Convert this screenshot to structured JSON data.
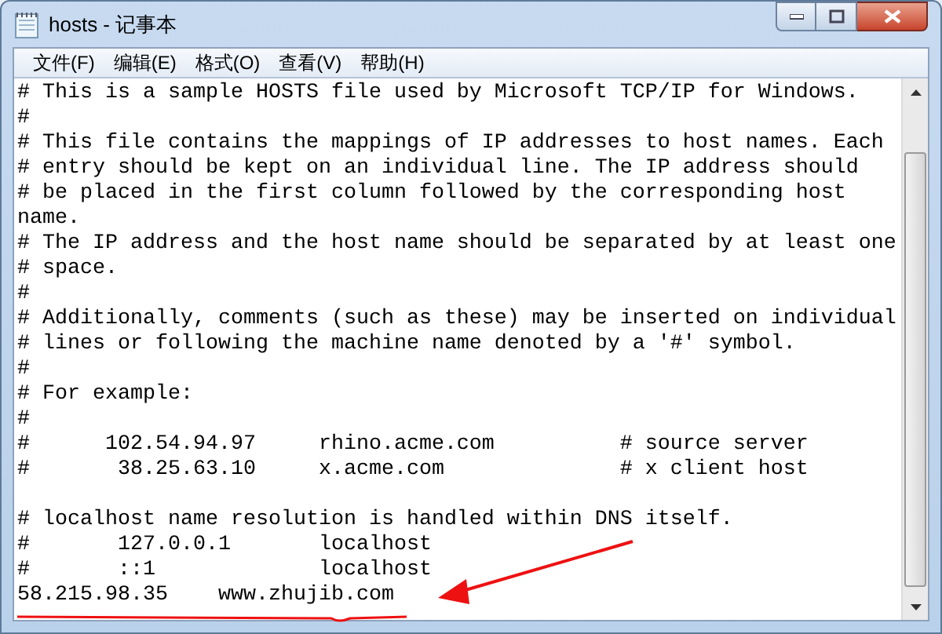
{
  "window": {
    "title": "hosts - 记事本"
  },
  "menu": [
    "文件(F)",
    "编辑(E)",
    "格式(O)",
    "查看(V)",
    "帮助(H)"
  ],
  "line_groups": [
    [
      "# This is a sample HOSTS file used by Microsoft TCP/IP for Windows.",
      "#",
      "# This file contains the mappings of IP addresses to host names. Each",
      "# entry should be kept on an individual line. The IP address should",
      "# be placed in the first column followed by the corresponding host",
      "name.",
      "# The IP address and the host name should be separated by at least one",
      "# space.",
      "#",
      "# Additionally, comments (such as these) may be inserted on individual",
      "# lines or following the machine name denoted by a '#' symbol.",
      "#",
      "# For example:",
      "#",
      "#      102.54.94.97     rhino.acme.com          # source server",
      "#       38.25.63.10     x.acme.com              # x client host"
    ],
    [
      "# localhost name resolution is handled within DNS itself.",
      "#       127.0.0.1       localhost",
      "#       ::1             localhost",
      "58.215.98.35    www.zhujib.com"
    ]
  ]
}
